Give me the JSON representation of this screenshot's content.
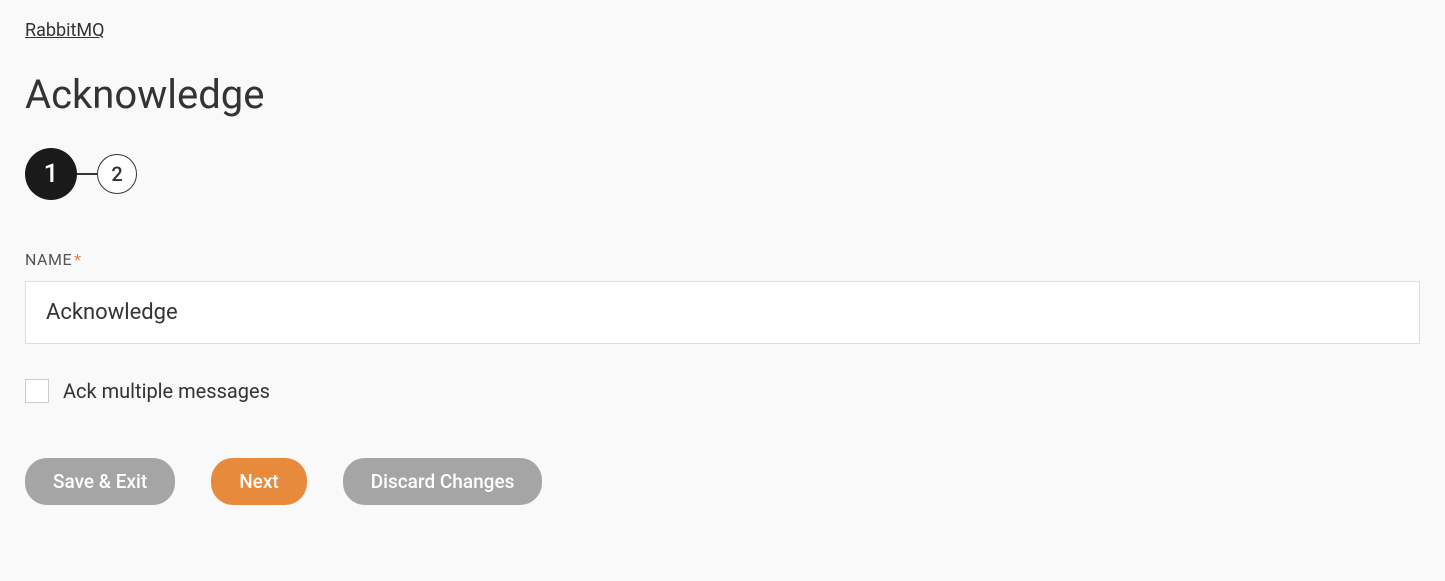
{
  "breadcrumb": {
    "link_text": "RabbitMQ"
  },
  "page": {
    "title": "Acknowledge"
  },
  "stepper": {
    "step1": "1",
    "step2": "2"
  },
  "form": {
    "name_label": "NAME",
    "required_mark": "*",
    "name_value": "Acknowledge",
    "ack_multiple_label": "Ack multiple messages"
  },
  "buttons": {
    "save_exit": "Save & Exit",
    "next": "Next",
    "discard": "Discard Changes"
  }
}
